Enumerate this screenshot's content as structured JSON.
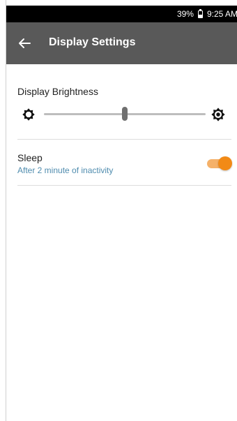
{
  "status_bar": {
    "battery": "39%",
    "time": "9:25 AM"
  },
  "app_bar": {
    "back_icon": "arrow-left-icon",
    "title": "Display Settings"
  },
  "brightness": {
    "label": "Display Brightness",
    "low_icon": "brightness-low-icon",
    "high_icon": "brightness-high-icon",
    "level": 0.5
  },
  "sleep": {
    "title": "Sleep",
    "subtitle": "After 2 minute of inactivity",
    "enabled": true
  },
  "colors": {
    "app_bar": "#595959",
    "status_bar": "#000000",
    "accent": "#f28a16",
    "subtitle": "#4f8cae"
  }
}
